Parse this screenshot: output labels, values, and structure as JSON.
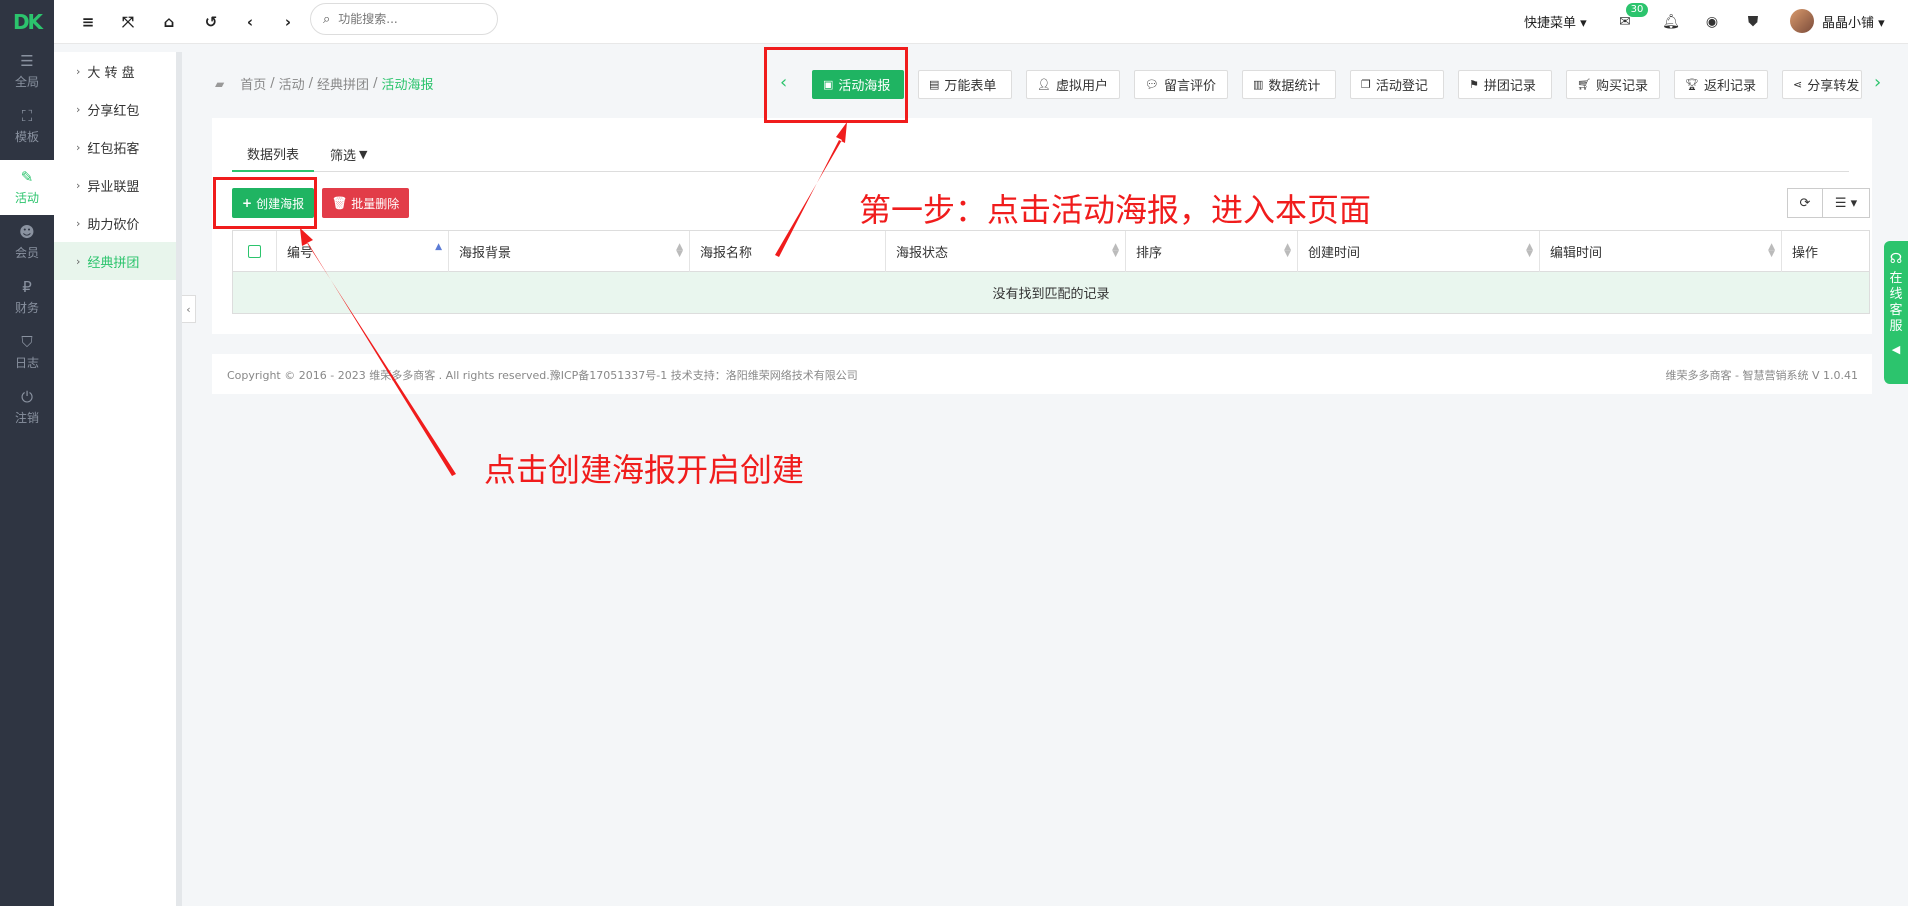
{
  "logo": "DK",
  "rail": [
    {
      "label": "全局",
      "icon": "sliders-icon"
    },
    {
      "label": "模板",
      "icon": "sitemap-icon"
    },
    {
      "label": "活动",
      "icon": "pen-icon"
    },
    {
      "label": "会员",
      "icon": "users-icon"
    },
    {
      "label": "财务",
      "icon": "paypal-icon"
    },
    {
      "label": "日志",
      "icon": "shield-icon"
    },
    {
      "label": "注销",
      "icon": "power-icon"
    }
  ],
  "subnav": [
    {
      "label": "大 转 盘"
    },
    {
      "label": "分享红包"
    },
    {
      "label": "红包拓客"
    },
    {
      "label": "异业联盟"
    },
    {
      "label": "助力砍价"
    },
    {
      "label": "经典拼团"
    }
  ],
  "topbar": {
    "search_placeholder": "功能搜索...",
    "quick_menu": "快捷菜单",
    "message_badge": "30",
    "username": "晶晶小铺"
  },
  "breadcrumb": {
    "home": "首页",
    "level1": "活动",
    "level2": "经典拼团",
    "current": "活动海报"
  },
  "quick_buttons": [
    {
      "label": "活动海报",
      "icon": "image-file-icon"
    },
    {
      "label": "万能表单",
      "icon": "file-icon"
    },
    {
      "label": "虚拟用户",
      "icon": "user-plus-icon"
    },
    {
      "label": "留言评价",
      "icon": "comments-icon"
    },
    {
      "label": "数据统计",
      "icon": "bar-chart-icon"
    },
    {
      "label": "活动登记",
      "icon": "copy-icon"
    },
    {
      "label": "拼团记录",
      "icon": "flag-icon"
    },
    {
      "label": "购买记录",
      "icon": "cart-icon"
    },
    {
      "label": "返利记录",
      "icon": "trophy-icon"
    },
    {
      "label": "分享转发",
      "icon": "share-icon"
    }
  ],
  "tabs": {
    "data_list": "数据列表",
    "filter": "筛选"
  },
  "actions": {
    "create": "创建海报",
    "batch_delete": "批量删除"
  },
  "table": {
    "columns": [
      "编号",
      "海报背景",
      "海报名称",
      "海报状态",
      "排序",
      "创建时间",
      "编辑时间",
      "操作"
    ],
    "empty_message": "没有找到匹配的记录"
  },
  "footer": {
    "copyright": "Copyright © 2016 - 2023 维荣多多商客 . All rights reserved.豫ICP备17051337号-1 技术支持：洛阳维荣网络技术有限公司",
    "version": "维荣多多商客 - 智慧营销系统 V 1.0.41"
  },
  "customer_service": {
    "label": "在线客服"
  },
  "annotations": {
    "step1": "第一步：点击活动海报，进入本页面",
    "step2": "点击创建海报开启创建"
  },
  "colors": {
    "accent": "#2cc46d",
    "danger": "#e23c48",
    "rail": "#2f3542",
    "annotation": "#f01c1c"
  }
}
